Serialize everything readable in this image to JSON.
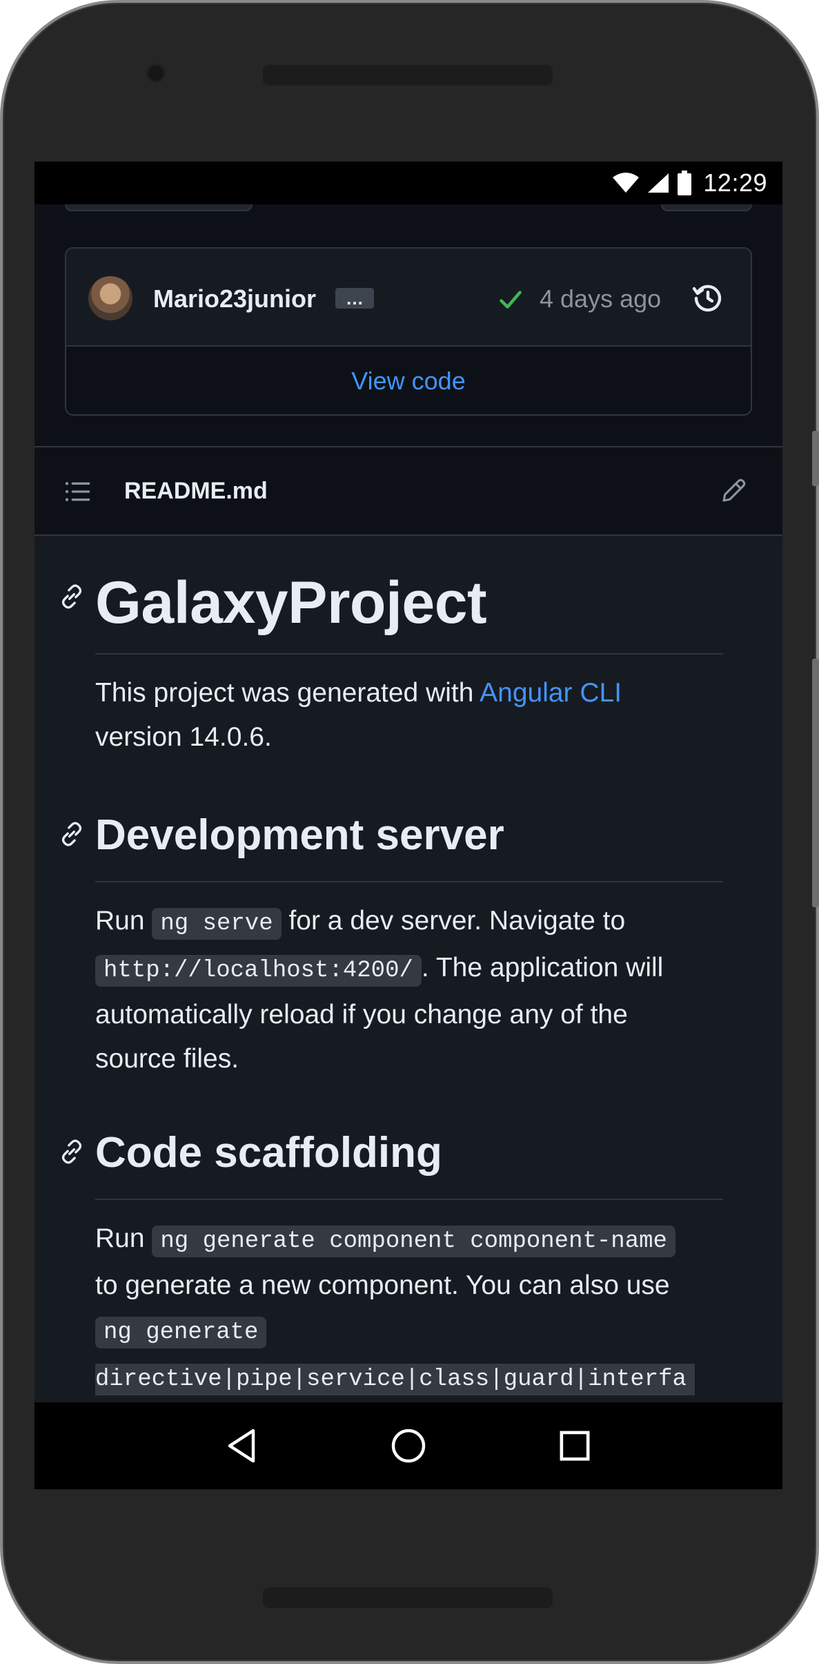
{
  "status_bar": {
    "time": "12:29",
    "icons": [
      "wifi-icon",
      "signal-icon",
      "battery-icon"
    ]
  },
  "commit": {
    "author": "Mario23junior",
    "ellipsis": "…",
    "time_ago": "4 days ago",
    "status_icon": "check-icon",
    "status_color": "#3fb950",
    "history_icon": "history-icon",
    "view_code_label": "View code"
  },
  "readme": {
    "filename": "README.md",
    "toc_icon": "list-icon",
    "edit_icon": "pencil-icon"
  },
  "markdown": {
    "title": "GalaxyProject",
    "intro_text_1": "This project was generated with ",
    "intro_link": "Angular CLI",
    "intro_text_2": "version 14.0.6.",
    "section1": {
      "heading": "Development server",
      "run": "Run ",
      "code1": "ng serve",
      "text1": " for a dev server. Navigate to",
      "code2": "http://localhost:4200/",
      "text2": ". The application will",
      "text3": "automatically reload if you change any of the",
      "text4": "source files."
    },
    "section2": {
      "heading": "Code scaffolding",
      "run": "Run ",
      "code1": "ng generate component component-name",
      "text1": "to generate a new component. You can also use",
      "code2": "ng generate",
      "code3": "directive|pipe|service|class|guard|interfa"
    }
  },
  "colors": {
    "background": "#0d1117",
    "link": "#4493f8",
    "text": "#e6edf3",
    "muted": "#8b949e",
    "border": "#30363d"
  },
  "nav_bar": {
    "icons": [
      "back-icon",
      "home-icon",
      "recents-icon"
    ]
  }
}
